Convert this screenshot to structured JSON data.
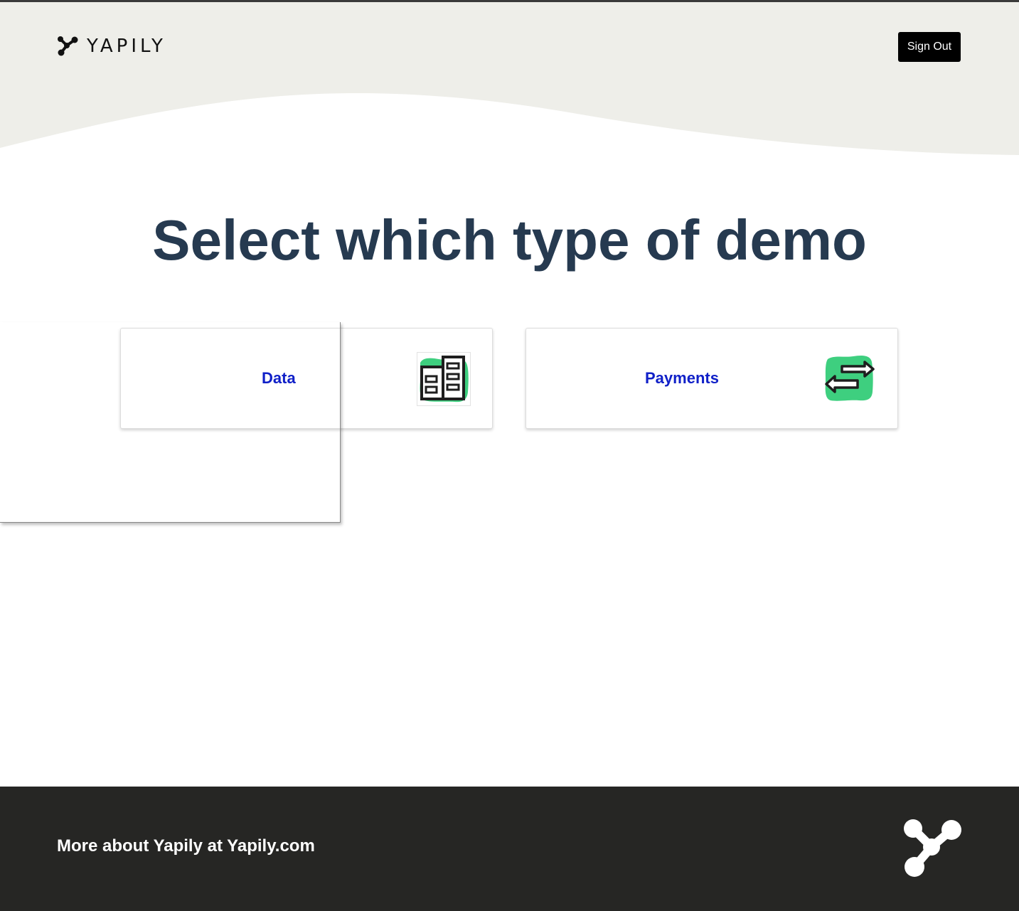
{
  "header": {
    "brand_name": "YAPILY",
    "sign_out_label": "Sign Out",
    "logo_icon": "yapily-molecule-icon",
    "background_color": "#eeeee9"
  },
  "main": {
    "title": "Select which type of demo",
    "cards": [
      {
        "label": "Data",
        "icon": "building-icon"
      },
      {
        "label": "Payments",
        "icon": "transfer-arrows-icon"
      }
    ],
    "title_color": "#263a50",
    "card_label_color": "#1020c8",
    "icon_accent_color": "#3ecf7f"
  },
  "footer": {
    "text": "More about Yapily at Yapily.com",
    "logo_icon": "yapily-molecule-icon",
    "background_color": "#262624"
  }
}
